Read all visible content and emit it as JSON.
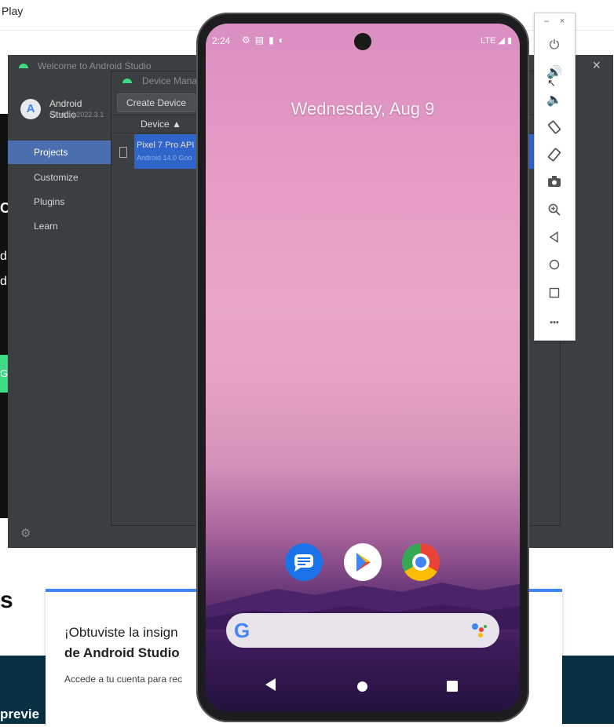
{
  "browser": {
    "tab_label": "Play"
  },
  "web_page": {
    "left_letters": [
      "C",
      "d",
      "dı"
    ],
    "left_button_letter": "G",
    "heading_fragment": "s",
    "footer_fragment": "previe",
    "card": {
      "line1": "¡Obtuviste la insign",
      "line2": "de Android Studio",
      "line3": "Accede a tu cuenta para rec"
    }
  },
  "studio": {
    "window_title": "Welcome to Android Studio",
    "close_icon": "close-icon",
    "brand_name": "Android Studio",
    "brand_version": "Giraffe | 2022.3.1",
    "nav": [
      "Projects",
      "Customize",
      "Plugins",
      "Learn"
    ],
    "active_nav": "Projects",
    "settings_icon": "gear-icon"
  },
  "device_manager": {
    "title": "Device Manager",
    "create_button": "Create Device",
    "column_header": "Device",
    "device_name": "Pixel 7 Pro API",
    "device_sub": "Android 14.0 Goo"
  },
  "emulator": {
    "status_time": "2:24",
    "status_icons": [
      "settings-icon",
      "messages-icon",
      "sim-icon",
      "data-saver-icon"
    ],
    "network": "LTE",
    "date_text": "Wednesday, Aug 9",
    "apps": [
      "Messages",
      "Play Store",
      "Chrome"
    ],
    "search_logo": "G",
    "nav_buttons": [
      "back-icon",
      "home-icon",
      "recents-icon"
    ]
  },
  "emulator_toolbar": {
    "minimize": "–",
    "close": "×",
    "tools": [
      "power-icon",
      "volume-up-icon",
      "volume-down-icon",
      "rotate-left-icon",
      "rotate-right-icon",
      "camera-icon",
      "zoom-icon",
      "back-icon",
      "home-icon",
      "overview-icon",
      "more-icon"
    ],
    "more_label": "•••"
  },
  "colors": {
    "studio_bg": "#3c3f41",
    "selection": "#4b6eaf",
    "device_row": "#2f65ca",
    "android_green": "#3ddc84",
    "footer_dark": "#073042"
  }
}
